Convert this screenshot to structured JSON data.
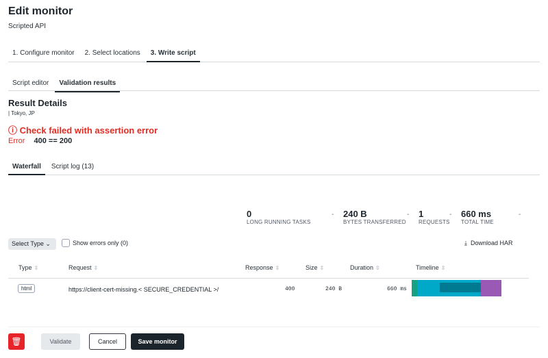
{
  "header": {
    "title": "Edit monitor",
    "subtitle": "Scripted API"
  },
  "steps": [
    {
      "label": "1. Configure monitor"
    },
    {
      "label": "2. Select locations"
    },
    {
      "label": "3. Write script",
      "active": true
    }
  ],
  "subtabs": [
    {
      "label": "Script editor"
    },
    {
      "label": "Validation results",
      "active": true
    }
  ],
  "result": {
    "title": "Result Details",
    "location": "| Tokyo, JP",
    "failure": "ⓘ Check failed with assertion error",
    "error_label": "Error",
    "error_value": "400 == 200"
  },
  "result_tabs": [
    {
      "label": "Waterfall",
      "active": true
    },
    {
      "label": "Script log (13)"
    }
  ],
  "summary": [
    {
      "value": "0",
      "label": "LONG RUNNING TASKS"
    },
    {
      "value": "240 B",
      "label": "BYTES TRANSFERRED"
    },
    {
      "value": "1",
      "label": "REQUESTS"
    },
    {
      "value": "660 ms",
      "label": "TOTAL TIME"
    }
  ],
  "filters": {
    "select_type": "Select Type ⌄",
    "errors_only": "Show errors only (0)",
    "download": "Download HAR"
  },
  "table": {
    "columns": [
      "Type",
      "Request",
      "Response",
      "Size",
      "Duration",
      "Timeline"
    ],
    "rows": [
      {
        "type": "html",
        "request": "https://client-cert-missing.< SECURE_CREDENTIAL >/",
        "response": "400",
        "size": "240 B",
        "duration": "660 ms",
        "timeline": [
          {
            "phase": "connect",
            "fraction": 0.06,
            "color": "#16a085"
          },
          {
            "phase": "ssl",
            "fraction": 0.69,
            "color": "#00a9c7"
          },
          {
            "phase": "receive",
            "fraction": 0.22,
            "color": "#9b59b6"
          }
        ]
      }
    ]
  },
  "footer": {
    "delete_icon": "trash-icon",
    "validate": "Validate",
    "cancel": "Cancel",
    "save": "Save monitor"
  }
}
